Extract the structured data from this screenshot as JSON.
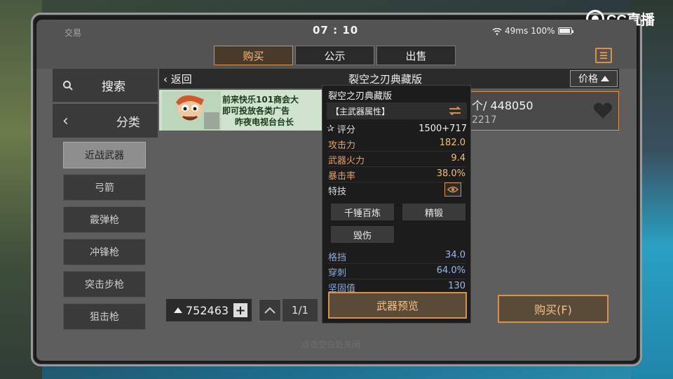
{
  "status": {
    "left_text": "交易",
    "time": "07 : 10",
    "ping": "49ms",
    "battery": "100%"
  },
  "brand": {
    "cc_label": "CC直播"
  },
  "tabs": [
    {
      "label": "购买",
      "active": true
    },
    {
      "label": "公示",
      "active": false
    },
    {
      "label": "出售",
      "active": false
    }
  ],
  "sidebar": {
    "search_label": "搜索",
    "category_label": "分类",
    "categories": [
      {
        "label": "近战武器",
        "active": true
      },
      {
        "label": "弓箭",
        "active": false
      },
      {
        "label": "霰弹枪",
        "active": false
      },
      {
        "label": "冲锋枪",
        "active": false
      },
      {
        "label": "突击步枪",
        "active": false
      },
      {
        "label": "狙击枪",
        "active": false
      }
    ]
  },
  "header": {
    "back_label": "返回",
    "title": "裂空之刃典藏版",
    "sort_label": "价格"
  },
  "ad": {
    "line1": "前来快乐101商会大",
    "line2": "即可投放各类广告",
    "line3": "昨夜电视台台长"
  },
  "listing": {
    "price": "个/ 448050",
    "sub": "2217"
  },
  "popup": {
    "title": "裂空之刃典藏版",
    "attr_label": "【主武器属性】",
    "score_label": "评分",
    "score_value": "1500+717",
    "stats": [
      {
        "name": "攻击力",
        "value": "182.0"
      },
      {
        "name": "武器火力",
        "value": "9.4"
      },
      {
        "name": "暴击率",
        "value": "38.0%"
      }
    ],
    "skill_label": "特技",
    "skills": [
      "千锤百炼",
      "精锻",
      "毁伤"
    ],
    "stats2": [
      {
        "name": "格挡",
        "value": "34.0"
      },
      {
        "name": "穿刺",
        "value": "64.0%"
      },
      {
        "name": "坚固值",
        "value": "130"
      }
    ],
    "preview_label": "武器预览"
  },
  "footer": {
    "currency": "752463",
    "page": "1/1",
    "buy_label": "购买(F)",
    "hint": "点击空白处关闭"
  },
  "colors": {
    "accent": "#d9914a",
    "panel": "#3a3a3a",
    "screen": "#5e5e5e"
  }
}
